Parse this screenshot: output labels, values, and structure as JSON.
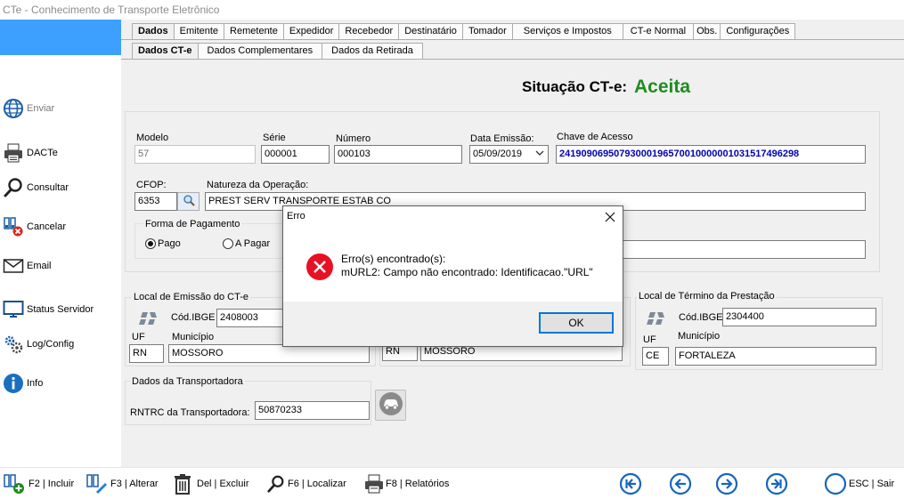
{
  "window": {
    "title": "CTe - Conhecimento de Transporte Eletrônico"
  },
  "sidebar": {
    "items": [
      {
        "label": "Enviar",
        "icon": "globe-icon"
      },
      {
        "label": "DACTe",
        "icon": "printer-icon"
      },
      {
        "label": "Consultar",
        "icon": "magnifier-icon"
      },
      {
        "label": "Cancelar",
        "icon": "cancel-doc-icon"
      },
      {
        "label": "Email",
        "icon": "envelope-icon"
      },
      {
        "label": "Status Servidor",
        "icon": "monitor-icon"
      },
      {
        "label": "Log/Config",
        "icon": "gears-icon"
      },
      {
        "label": "Info",
        "icon": "info-icon"
      }
    ]
  },
  "tabs": {
    "main": [
      "Dados",
      "Emitente",
      "Remetente",
      "Expedidor",
      "Recebedor",
      "Destinatário",
      "Tomador",
      "Serviços e Impostos",
      "CT-e Normal",
      "Obs.",
      "Configurações"
    ],
    "sub": [
      "Dados CT-e",
      "Dados Complementares",
      "Dados da Retirada"
    ]
  },
  "status": {
    "label": "Situação CT-e:",
    "value": "Aceita",
    "color": "#1e8c1e"
  },
  "form": {
    "modelo_label": "Modelo",
    "modelo": "57",
    "serie_label": "Série",
    "serie": "000001",
    "numero_label": "Número",
    "numero": "000103",
    "data_label": "Data Emissão:",
    "data": "05/09/2019",
    "chave_label": "Chave de Acesso",
    "chave": "24190906950793000196570010000001031517496298",
    "cfop_label": "CFOP:",
    "cfop": "6353",
    "natureza_label": "Natureza da Operação:",
    "natureza": "PREST SERV TRANSPORTE ESTAB CO",
    "pagamento_label": "Forma de Pagamento",
    "pago_label": "Pago",
    "apagar_label": "A Pagar"
  },
  "emissao": {
    "title": "Local de Emissão do CT-e",
    "ibge_label": "Cód.IBGE",
    "ibge": "2408003",
    "uf_label": "UF",
    "uf": "RN",
    "municipio_label": "Município",
    "municipio": "MOSSORO"
  },
  "inicio": {
    "uf": "RN",
    "municipio": "MOSSORO"
  },
  "termino": {
    "title": "Local de Término da Prestação",
    "ibge_label": "Cód.IBGE",
    "ibge": "2304400",
    "uf_label": "UF",
    "uf": "CE",
    "municipio_label": "Município",
    "municipio": "FORTALEZA"
  },
  "transportadora": {
    "title": "Dados da Transportadora",
    "rntrc_label": "RNTRC  da Transportadora:",
    "rntrc": "50870233"
  },
  "toolbar": {
    "incluir": "F2 | Incluir",
    "alterar": "F3 | Alterar",
    "excluir": "Del | Excluir",
    "localizar": "F6 | Localizar",
    "relatorios": "F8 | Relatórios",
    "sair": "ESC | Sair"
  },
  "dialog": {
    "title": "Erro",
    "line1": "Erro(s) encontrado(s):",
    "line2": "mURL2: Campo não encontrado: Identificacao.\"URL\"",
    "ok": "OK"
  },
  "colors": {
    "accent": "#0078d7",
    "sidebar_top": "#3da0ff",
    "nav_icon": "#1565c0",
    "error": "#e81123"
  }
}
